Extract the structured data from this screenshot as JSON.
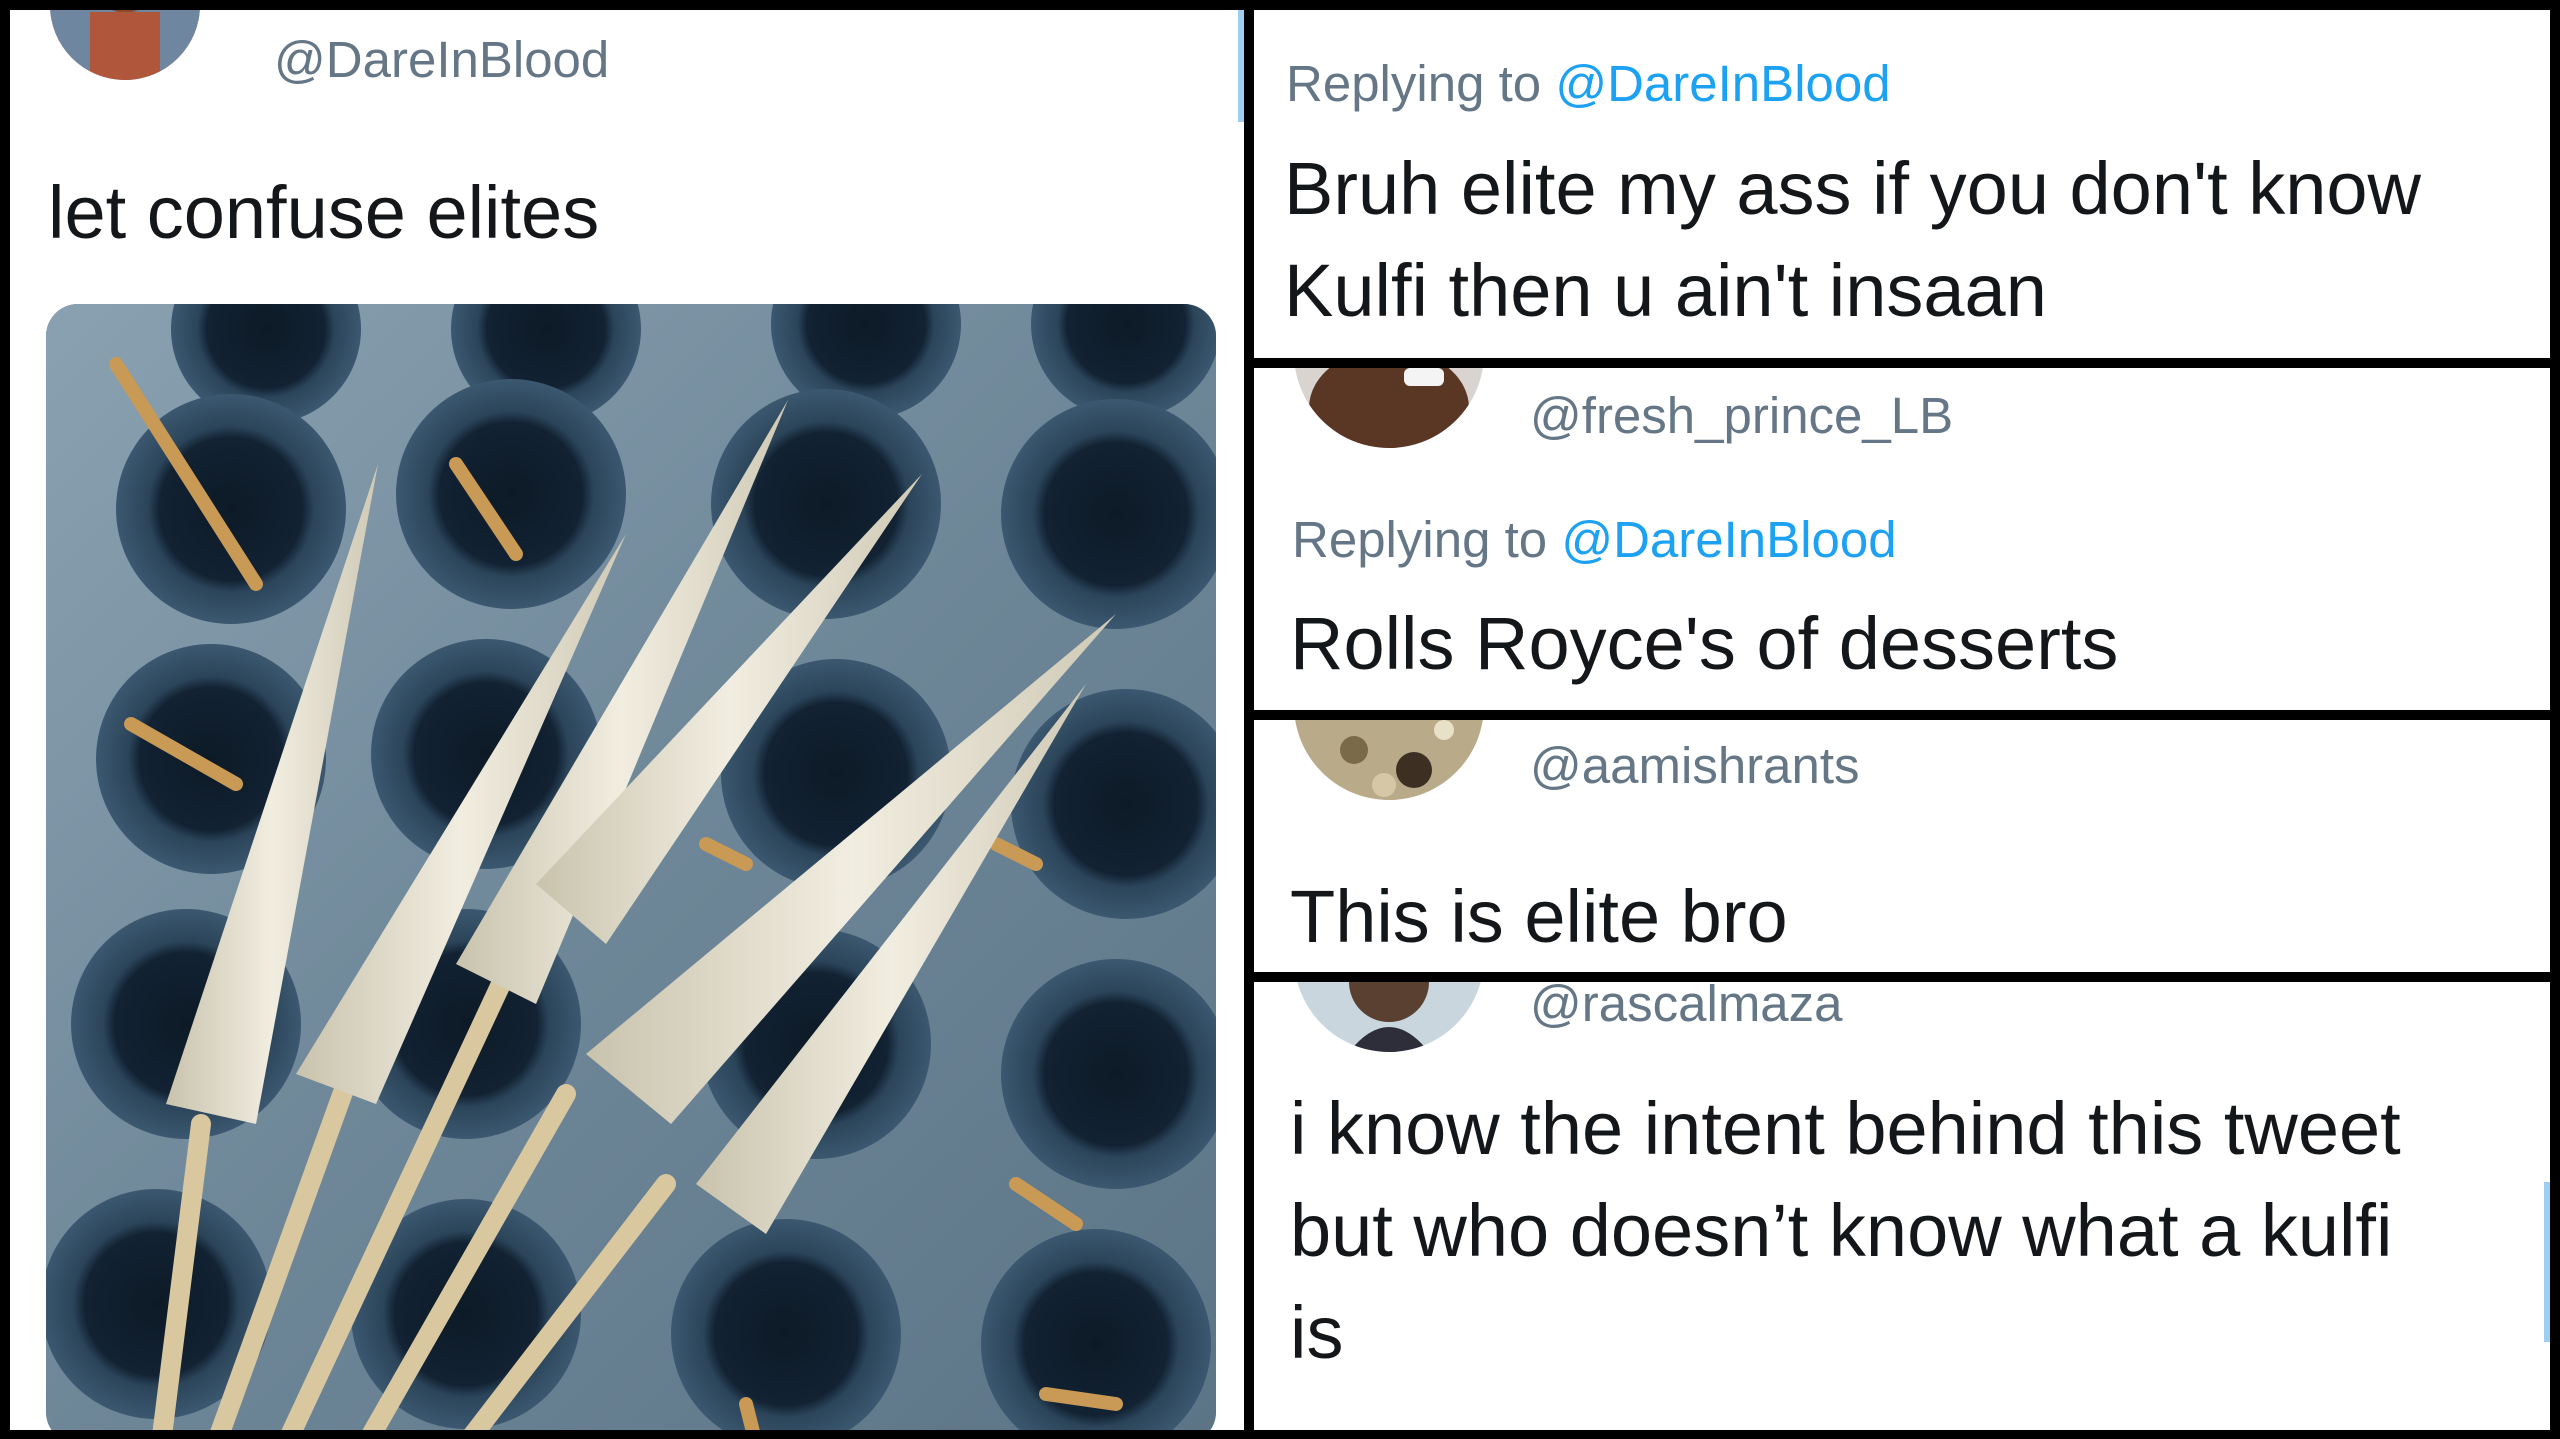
{
  "main_tweet": {
    "handle": "@DareInBlood",
    "text": "let confuse elites",
    "image_alt": "kulfi-photo"
  },
  "replies": [
    {
      "replying_label": "Replying to",
      "mention": "@DareInBlood",
      "text_lines": [
        "Bruh elite my ass if you don't know",
        "Kulfi then u ain't insaan"
      ]
    },
    {
      "handle": "@fresh_prince_LB",
      "replying_label": "Replying to",
      "mention": "@DareInBlood",
      "text": "Rolls Royce's of desserts"
    },
    {
      "handle": "@aamishrants",
      "text": "This is elite bro"
    },
    {
      "handle": "@rascalmaza",
      "text_lines": [
        "i know the intent behind this tweet",
        "but who doesn’t know what a kulfi",
        "is"
      ]
    }
  ],
  "colors": {
    "handle_gray": "#657786",
    "mention_blue": "#1da1f2",
    "text_dark": "#14171a",
    "separator": "#000000"
  }
}
